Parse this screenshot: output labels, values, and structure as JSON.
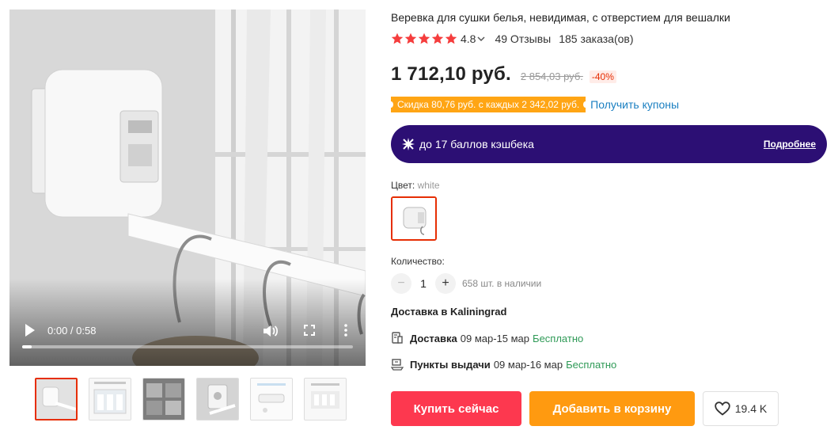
{
  "product": {
    "title": "Веревка для сушки белья, невидимая, с отверстием для вешалки",
    "rating": "4.8",
    "reviews": "49 Отзывы",
    "orders": "185 заказа(ов)",
    "price": "1 712,10 руб.",
    "old_price": "2 854,03 руб.",
    "discount": "-40%"
  },
  "coupon": {
    "badge": "Скидка 80,76 руб. с каждых 2 342,02 руб.",
    "link": "Получить купоны"
  },
  "cashback": {
    "text": "до 17 баллов кэшбека",
    "more": "Подробнее"
  },
  "color": {
    "label": "Цвет:",
    "value": "white"
  },
  "quantity": {
    "label": "Количество:",
    "minus": "−",
    "value": "1",
    "plus": "+",
    "stock": "658 шт. в наличии"
  },
  "delivery": {
    "heading": "Доставка в Kaliningrad",
    "options": [
      {
        "name": "Доставка",
        "dates": "09 мар-15 мар",
        "price": "Бесплатно"
      },
      {
        "name": "Пункты выдачи",
        "dates": "09 мар-16 мар",
        "price": "Бесплатно"
      }
    ]
  },
  "video": {
    "time": "0:00 / 0:58",
    "progress_fraction": 0.028
  },
  "actions": {
    "buy": "Купить сейчас",
    "cart": "Добавить в корзину",
    "wishlist_count": "19.4 K"
  },
  "colors": {
    "accent_red": "#e62e04",
    "buy_button": "#fd384f",
    "cart_button": "#ff9a10",
    "cashback_bg": "#2c0f74",
    "coupon_bg": "#ffa514",
    "link_blue": "#1a7fc1",
    "free_green": "#2f9a57",
    "star": "#f53d3d"
  },
  "icons": {
    "star": "star-icon",
    "chevron": "chevron-down-icon",
    "cashback": "sparkle-icon",
    "delivery": "courier-icon",
    "pickup": "pickup-point-icon",
    "wishlist": "heart-icon",
    "play": "play-icon",
    "volume": "volume-icon",
    "fullscreen": "fullscreen-icon",
    "more": "more-vertical-icon"
  }
}
